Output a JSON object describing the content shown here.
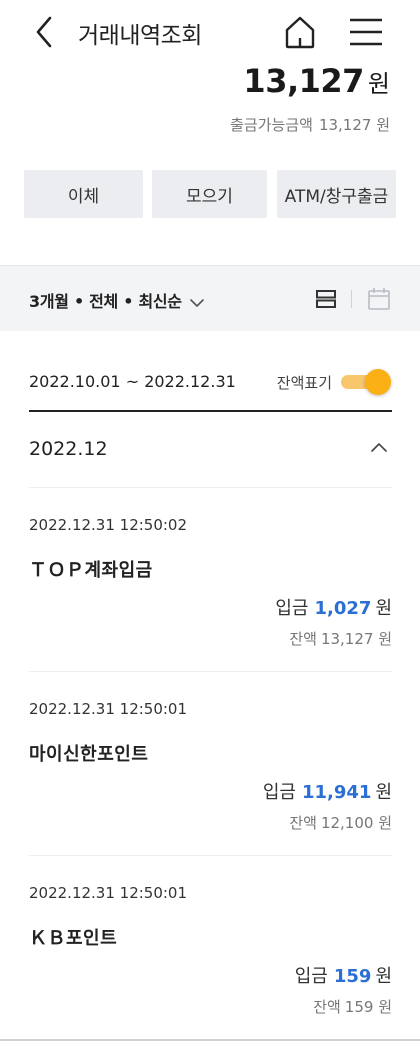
{
  "header": {
    "title": "거래내역조회",
    "icons": {
      "back": "chevron-left-icon",
      "home": "home-icon",
      "menu": "hamburger-menu-icon"
    }
  },
  "balance": {
    "amount": "13,127",
    "unit": "원",
    "available_label": "출금가능금액",
    "available_value": "13,127 원"
  },
  "actions": [
    "이체",
    "모으기",
    "ATM/창구출금"
  ],
  "filter": {
    "label": "3개월 • 전체 • 최신순",
    "icons": {
      "dropdown": "chevron-down-icon",
      "list_view": "list-view-icon",
      "calendar": "calendar-icon"
    }
  },
  "period": {
    "range": "2022.10.01 ~ 2022.12.31",
    "toggle_label": "잔액표기",
    "toggle_on": true
  },
  "month": {
    "label": "2022.12",
    "icon": "chevron-up-icon"
  },
  "transactions": [
    {
      "datetime": "2022.12.31 12:50:02",
      "name": "ＴＯＰ계좌입금",
      "type": "입금",
      "amount": "1,027",
      "unit": "원",
      "balance_label": "잔액",
      "balance": "13,127 원"
    },
    {
      "datetime": "2022.12.31 12:50:01",
      "name": "마이신한포인트",
      "type": "입금",
      "amount": "11,941",
      "unit": "원",
      "balance_label": "잔액",
      "balance": "12,100 원"
    },
    {
      "datetime": "2022.12.31 12:50:01",
      "name": "ＫＢ포인트",
      "type": "입금",
      "amount": "159",
      "unit": "원",
      "balance_label": "잔액",
      "balance": "159 원"
    }
  ],
  "colors": {
    "accent_blue": "#2b6fd6",
    "toggle_yellow": "#fbb116",
    "button_bg": "#ebedf0",
    "filter_bg": "#f3f4f6"
  }
}
